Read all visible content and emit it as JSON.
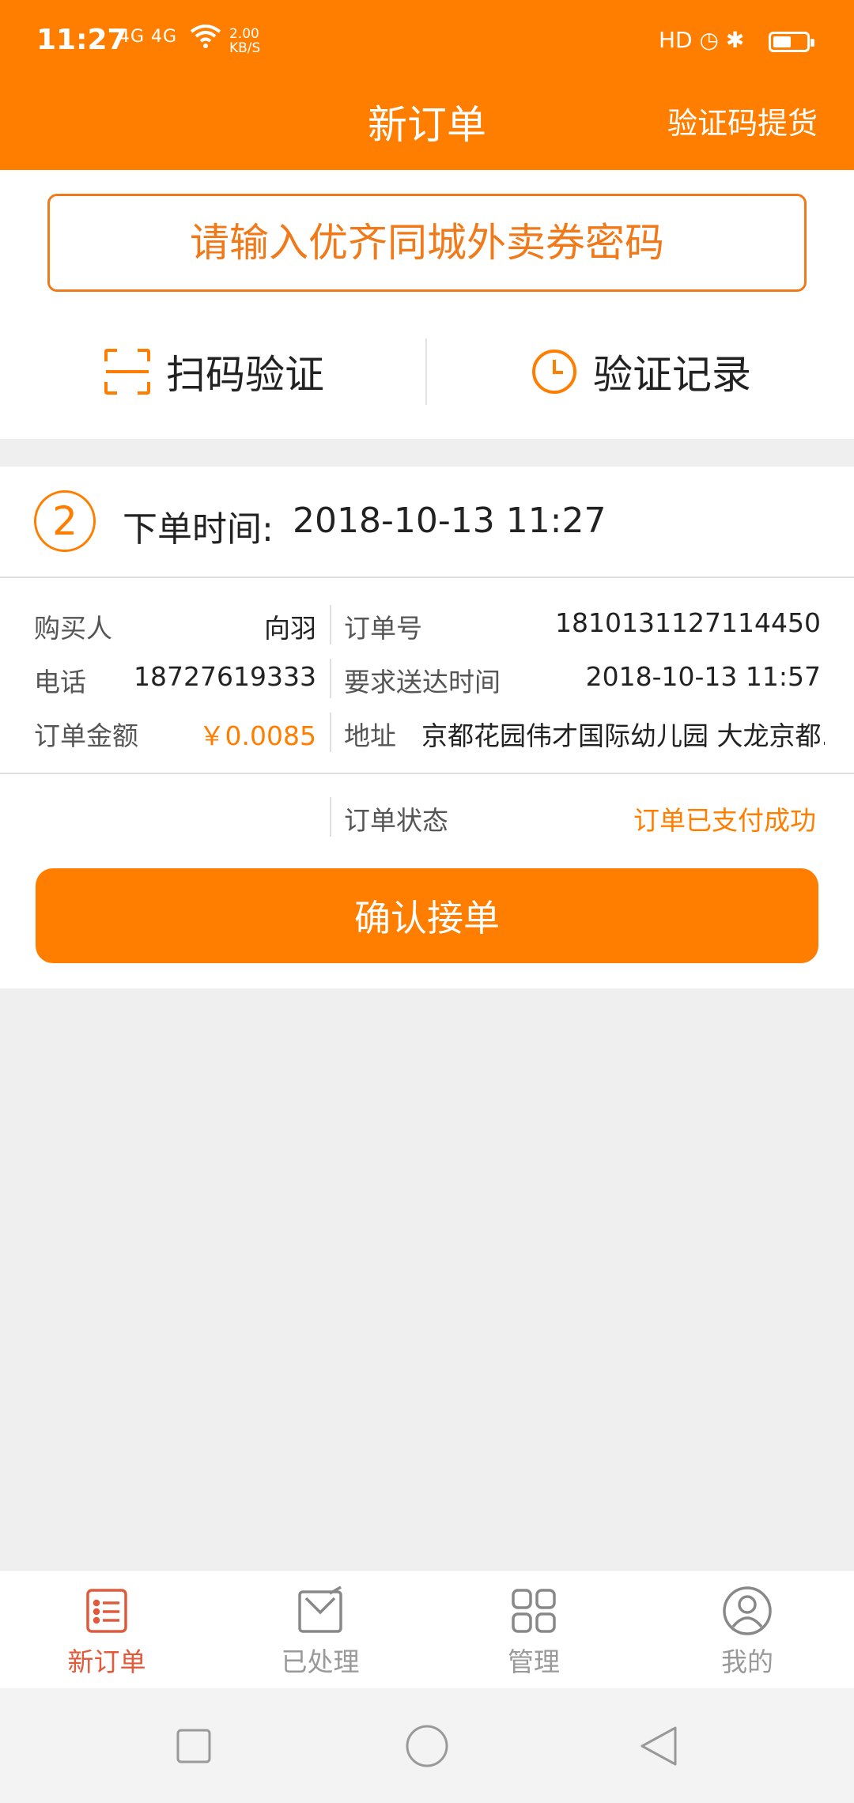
{
  "status_bar": {
    "time": "11:27",
    "network": "4G 4G",
    "speed": "2.00\nKB/S",
    "right_icons": "HD ◷ ✱"
  },
  "header": {
    "title": "新订单",
    "right_action": "验证码提货"
  },
  "verify": {
    "placeholder": "请输入优齐同城外卖券密码",
    "scan_label": "扫码验证",
    "record_label": "验证记录"
  },
  "order": {
    "index": "2",
    "time_label": "下单时间:",
    "time_value": "2018-10-13 11:27",
    "buyer_label": "购买人",
    "buyer_value": "向羽",
    "order_no_label": "订单号",
    "order_no_value": "1810131127114450",
    "phone_label": "电话",
    "phone_value": "18727619333",
    "deliver_time_label": "要求送达时间",
    "deliver_time_value": "2018-10-13 11:57",
    "amount_label": "订单金额",
    "amount_value": "￥0.0085",
    "address_label": "地址",
    "address_value": "京都花园伟才国际幼儿园 大龙京都...",
    "status_label": "订单状态",
    "status_value": "订单已支付成功",
    "confirm_label": "确认接单"
  },
  "bottom_nav": {
    "items": [
      {
        "label": "新订单",
        "icon": "list-icon",
        "active": true
      },
      {
        "label": "已处理",
        "icon": "processed-icon",
        "active": false
      },
      {
        "label": "管理",
        "icon": "grid-icon",
        "active": false
      },
      {
        "label": "我的",
        "icon": "user-icon",
        "active": false
      }
    ]
  },
  "colors": {
    "brand": "#ff7e00",
    "input_border": "#f07a19",
    "nav_active": "#e05a3b"
  }
}
